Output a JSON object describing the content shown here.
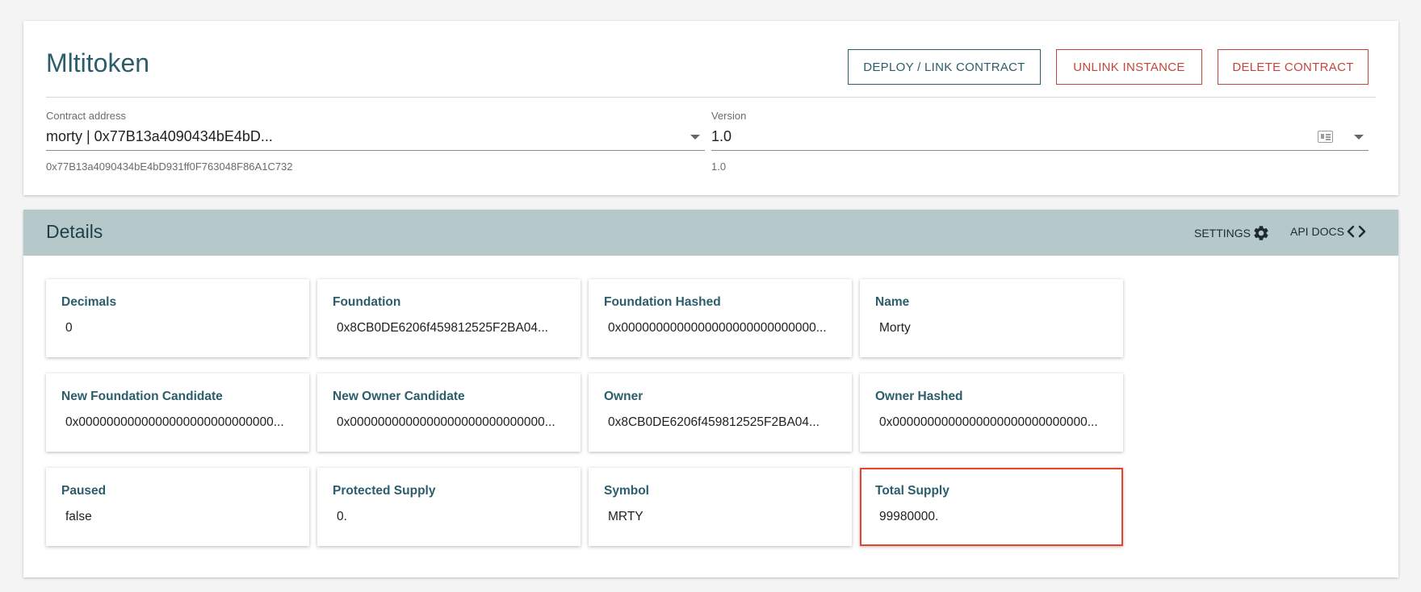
{
  "header": {
    "title": "Mltitoken",
    "buttons": {
      "deploy": "DEPLOY / LINK CONTRACT",
      "unlink": "UNLINK INSTANCE",
      "delete": "DELETE CONTRACT"
    }
  },
  "contract_address": {
    "label": "Contract address",
    "value": "morty | 0x77B13a4090434bE4bD...",
    "helper": "0x77B13a4090434bE4bD931ff0F763048F86A1C732"
  },
  "version": {
    "label": "Version",
    "value": "1.0",
    "helper": "1.0"
  },
  "details": {
    "title": "Details",
    "settings_label": "SETTINGS",
    "api_docs_label": "API DOCS",
    "properties": [
      {
        "label": "Decimals",
        "value": "0"
      },
      {
        "label": "Foundation",
        "value": "0x8CB0DE6206f459812525F2BA04..."
      },
      {
        "label": "Foundation Hashed",
        "value": "0x0000000000000000000000000000..."
      },
      {
        "label": "Name",
        "value": "Morty"
      },
      {
        "label": "New Foundation Candidate",
        "value": "0x0000000000000000000000000000..."
      },
      {
        "label": "New Owner Candidate",
        "value": "0x0000000000000000000000000000..."
      },
      {
        "label": "Owner",
        "value": "0x8CB0DE6206f459812525F2BA04..."
      },
      {
        "label": "Owner Hashed",
        "value": "0x0000000000000000000000000000..."
      },
      {
        "label": "Paused",
        "value": "false"
      },
      {
        "label": "Protected Supply",
        "value": "0."
      },
      {
        "label": "Symbol",
        "value": "MRTY"
      },
      {
        "label": "Total Supply",
        "value": "99980000."
      }
    ]
  },
  "colors": {
    "accent": "#2b5d6b",
    "danger": "#c4453a",
    "details_bar": "#b5c9ca",
    "highlight": "#e8432f"
  }
}
